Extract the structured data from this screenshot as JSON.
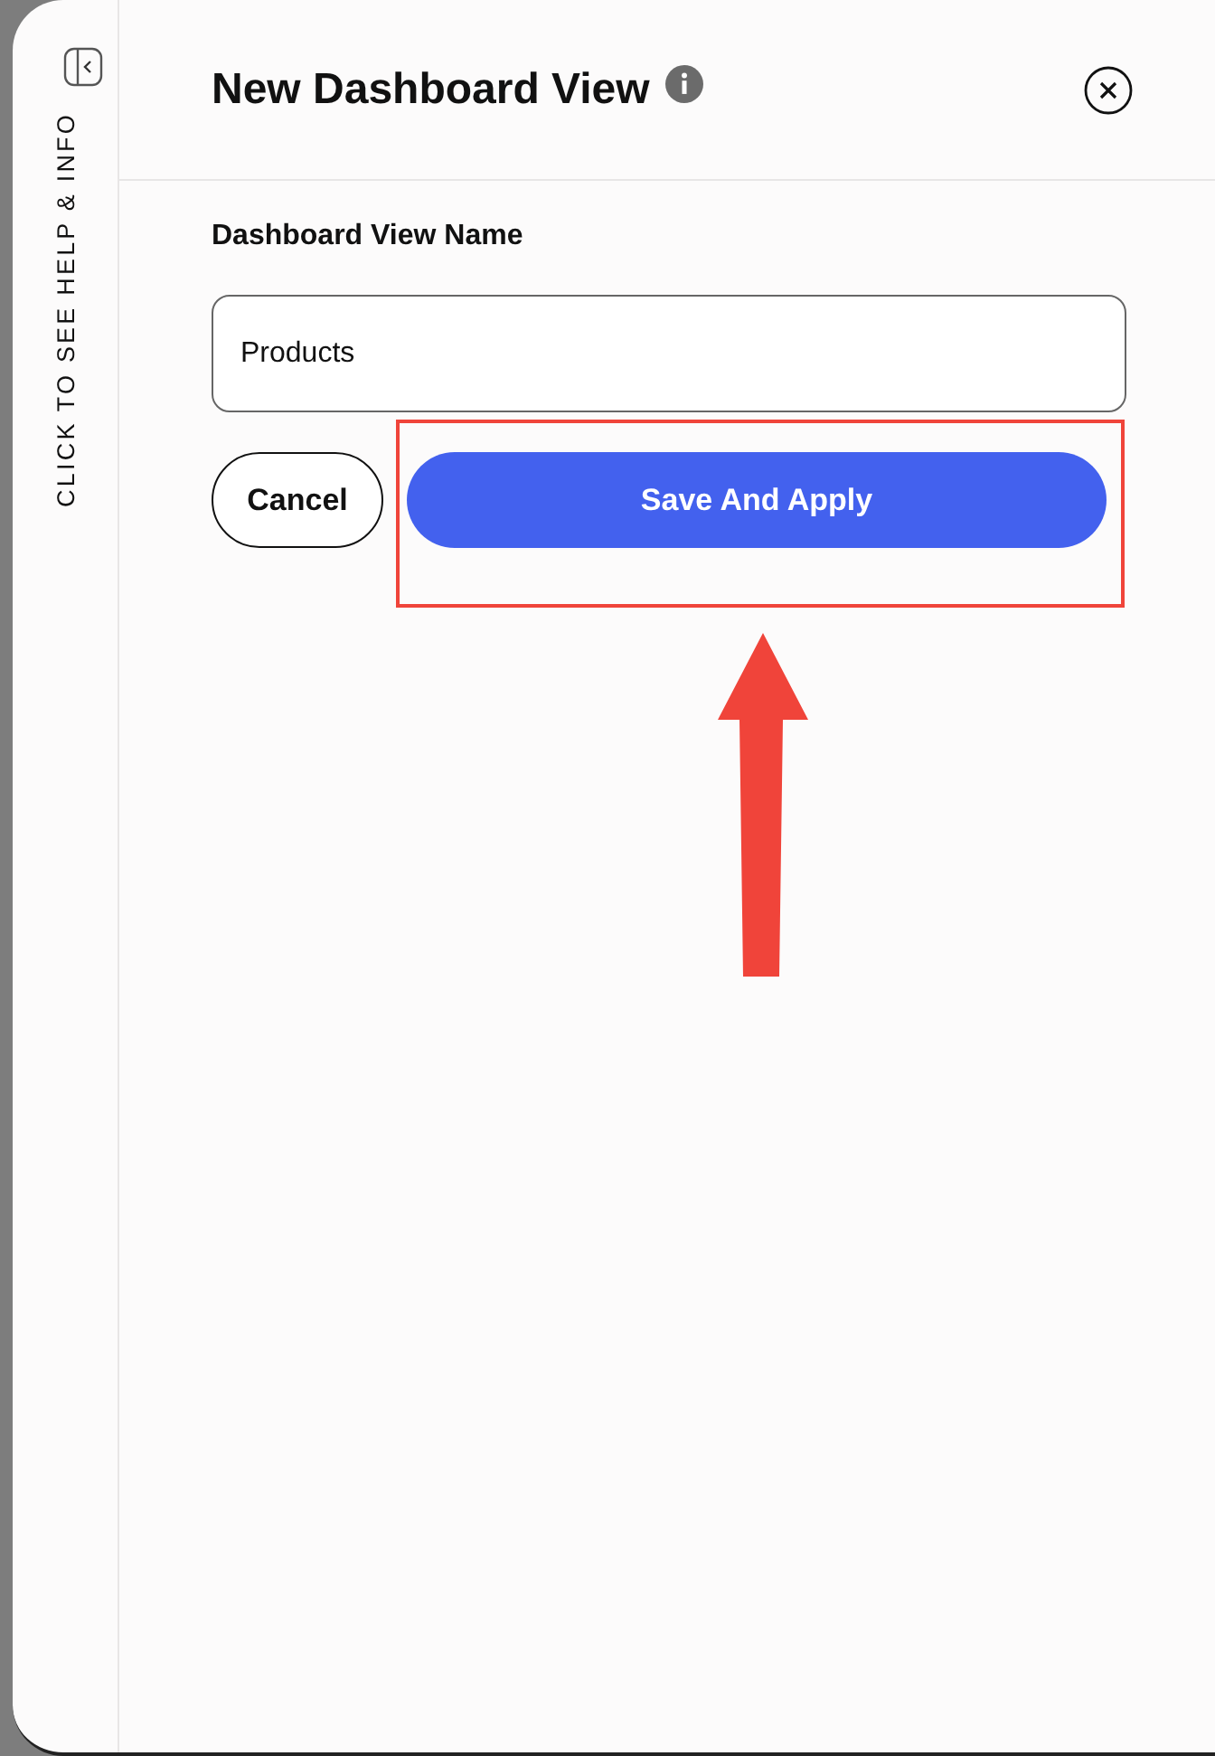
{
  "help_rail": {
    "label": "CLICK TO SEE HELP & INFO"
  },
  "dialog": {
    "title": "New Dashboard View",
    "field": {
      "label": "Dashboard View Name",
      "value": "Products"
    },
    "buttons": [
      {
        "label": "Cancel",
        "kind": "secondary"
      },
      {
        "label": "Save And Apply",
        "kind": "primary"
      }
    ]
  }
}
